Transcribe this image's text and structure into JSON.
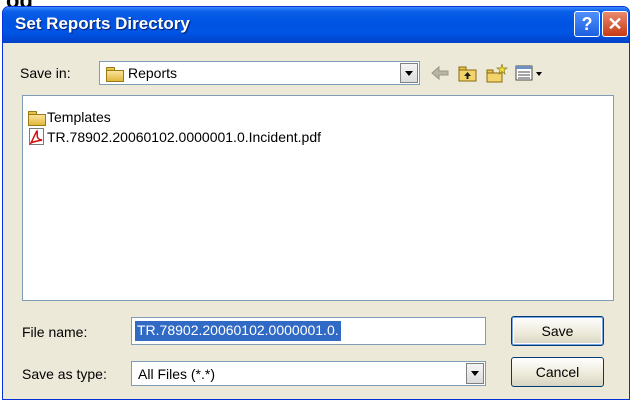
{
  "background_text": "og",
  "window": {
    "title": "Set Reports Directory",
    "help_glyph": "?",
    "close_glyph": "✕"
  },
  "save_in": {
    "label": "Save in:",
    "value": "Reports"
  },
  "toolbar": {
    "back_icon": "back-arrow-icon",
    "up_icon": "up-folder-icon",
    "new_folder_icon": "new-folder-icon",
    "view_icon": "view-menu-icon"
  },
  "file_list": {
    "items": [
      {
        "name": "Templates",
        "type": "folder"
      },
      {
        "name": "TR.78902.20060102.0000001.0.Incident.pdf",
        "type": "pdf"
      }
    ]
  },
  "file_name": {
    "label": "File name:",
    "value": "TR.78902.20060102.0000001.0."
  },
  "save_as_type": {
    "label": "Save as type:",
    "value": "All Files (*.*)"
  },
  "buttons": {
    "save": "Save",
    "cancel": "Cancel"
  },
  "colors": {
    "titlebar": "#0054e3",
    "dialog_bg": "#ece9d8",
    "selection": "#316ac5"
  }
}
